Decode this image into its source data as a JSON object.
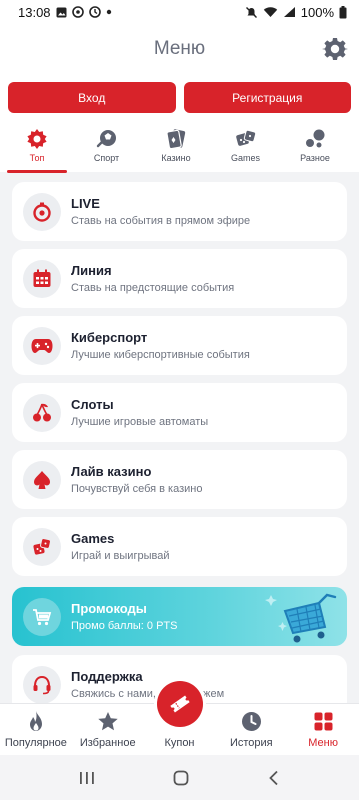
{
  "status_bar": {
    "time": "13:08",
    "battery": "100%"
  },
  "header": {
    "title": "Меню"
  },
  "auth": {
    "login": "Вход",
    "register": "Регистрация"
  },
  "tabs": [
    {
      "label": "Топ",
      "icon": "top-badge-icon",
      "active": true
    },
    {
      "label": "Спорт",
      "icon": "sport-ball-icon"
    },
    {
      "label": "Казино",
      "icon": "casino-cards-icon"
    },
    {
      "label": "Games",
      "icon": "dice-icon"
    },
    {
      "label": "Разное",
      "icon": "misc-circles-icon"
    }
  ],
  "menu": [
    {
      "title": "LIVE",
      "subtitle": "Ставь на события в прямом эфире",
      "icon": "stopwatch-icon"
    },
    {
      "title": "Линия",
      "subtitle": "Ставь на предстоящие события",
      "icon": "calendar-icon"
    },
    {
      "title": "Киберспорт",
      "subtitle": "Лучшие киберспортивные события",
      "icon": "gamepad-icon"
    },
    {
      "title": "Слоты",
      "subtitle": "Лучшие игровые автоматы",
      "icon": "cherries-icon"
    },
    {
      "title": "Лайв казино",
      "subtitle": "Почувствуй себя в казино",
      "icon": "spade-icon"
    },
    {
      "title": "Games",
      "subtitle": "Играй и выигрывай",
      "icon": "dice-icon"
    }
  ],
  "promo": {
    "title": "Промокоды",
    "subtitle": "Промо баллы: 0 PTS",
    "icon": "cart-icon"
  },
  "support": {
    "title": "Поддержка",
    "subtitle": "Свяжись с нами, мы поможем",
    "icon": "headset-icon"
  },
  "bottom_nav": [
    {
      "label": "Популярное",
      "icon": "flame-icon"
    },
    {
      "label": "Избранное",
      "icon": "star-icon"
    },
    {
      "label": "Купон",
      "icon": "ticket-icon"
    },
    {
      "label": "История",
      "icon": "clock-icon"
    },
    {
      "label": "Меню",
      "icon": "grid-icon",
      "active": true
    }
  ],
  "colors": {
    "accent": "#d8232a",
    "promo": "#27c2d0",
    "background": "#f2f3f5"
  }
}
